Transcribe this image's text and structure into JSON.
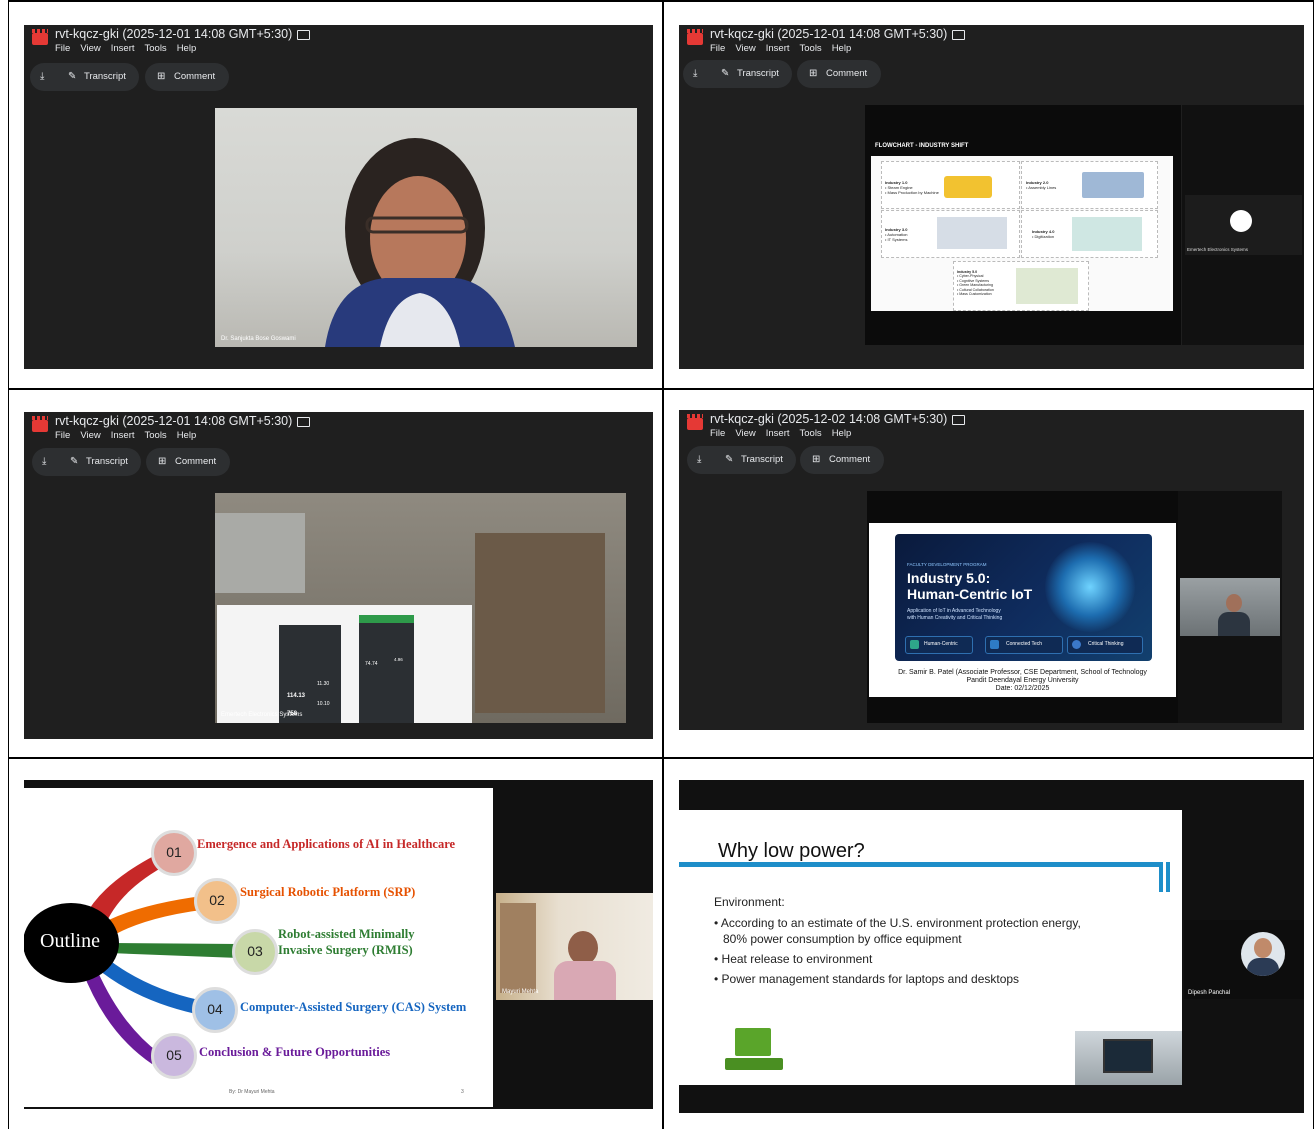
{
  "app": {
    "title_1": "rvt-kqcz-gki (2025-12-01 14:08 GMT+5:30)",
    "title_2": "rvt-kqcz-gki (2025-12-01 14:08 GMT+5:30)",
    "title_3": "rvt-kqcz-gki (2025-12-01 14:08 GMT+5:30)",
    "title_4": "rvt-kqcz-gki (2025-12-02 14:08 GMT+5:30)",
    "menu": [
      "File",
      "View",
      "Insert",
      "Tools",
      "Help"
    ],
    "toolbar": {
      "transcript": "Transcript",
      "comment": "Comment"
    }
  },
  "panels": {
    "p1": {
      "speaker": "Dr. Sanjukta Bose Goswami"
    },
    "p2": {
      "slide_title": "FLOWCHART - INDUSTRY SHIFT",
      "boxes": [
        {
          "title": "Industry 1.0",
          "items": [
            "Steam Engine",
            "Mass Production by Machine"
          ]
        },
        {
          "title": "Industry 2.0",
          "items": [
            "Assembly Lines"
          ]
        },
        {
          "title": "Industry 3.0",
          "items": [
            "Automation",
            "IT Systems"
          ]
        },
        {
          "title": "Industry 4.0",
          "items": [
            "Digitization"
          ]
        },
        {
          "title": "Industry 5.0",
          "items": [
            "Cyber-Physical",
            "Cognitive Systems",
            "Green Manufacturing",
            "Cultural Collaboration",
            "Mass Customization"
          ]
        }
      ],
      "side_label": "Emertech Electronics Systems"
    },
    "p3": {
      "speaker": "Emertech Electronics Systems",
      "values": [
        "114.13",
        "11.30",
        "758",
        "10.10",
        "74.74",
        "4.96"
      ]
    },
    "p4": {
      "kicker": "FACULTY DEVELOPMENT PROGRAM",
      "heading_1": "Industry 5.0:",
      "heading_2": "Human-Centric IoT",
      "sub_1": "Application of IoT in Advanced Technology",
      "sub_2": "with Human Creativity and Critical Thinking",
      "chips": [
        "Human-Centric",
        "Connected Tech",
        "Critical Thinking"
      ],
      "credit_1": "Dr. Samir B. Patel (Associate Professor, CSE Department, School of Technology",
      "credit_2": "Pandit Deendayal Energy University",
      "credit_3": "Date: 02/12/2025"
    },
    "p5": {
      "center": "Outline",
      "items": [
        {
          "num": "01",
          "text": "Emergence and Applications of AI in Healthcare",
          "color": "#c62828"
        },
        {
          "num": "02",
          "text": "Surgical Robotic Platform (SRP)",
          "color": "#e65100"
        },
        {
          "num": "03",
          "text_1": "Robot-assisted Minimally",
          "text_2": "Invasive Surgery (RMIS)",
          "color": "#2e7d32"
        },
        {
          "num": "04",
          "text": "Computer-Assisted Surgery (CAS) System",
          "color": "#1565c0"
        },
        {
          "num": "05",
          "text": "Conclusion & Future Opportunities",
          "color": "#6a1b9a"
        }
      ],
      "footer": "By: Dr Mayuri Mehta",
      "page": "3",
      "speaker": "Mayuri Mehta"
    },
    "p6": {
      "title": "Why low power?",
      "section": "Environment:",
      "bullets": [
        "According to an estimate of the U.S. environment protection energy,",
        "80% power consumption by office equipment",
        "Heat release  to environment",
        "Power management standards for laptops and desktops"
      ],
      "speaker": "Dipesh Panchal"
    }
  }
}
